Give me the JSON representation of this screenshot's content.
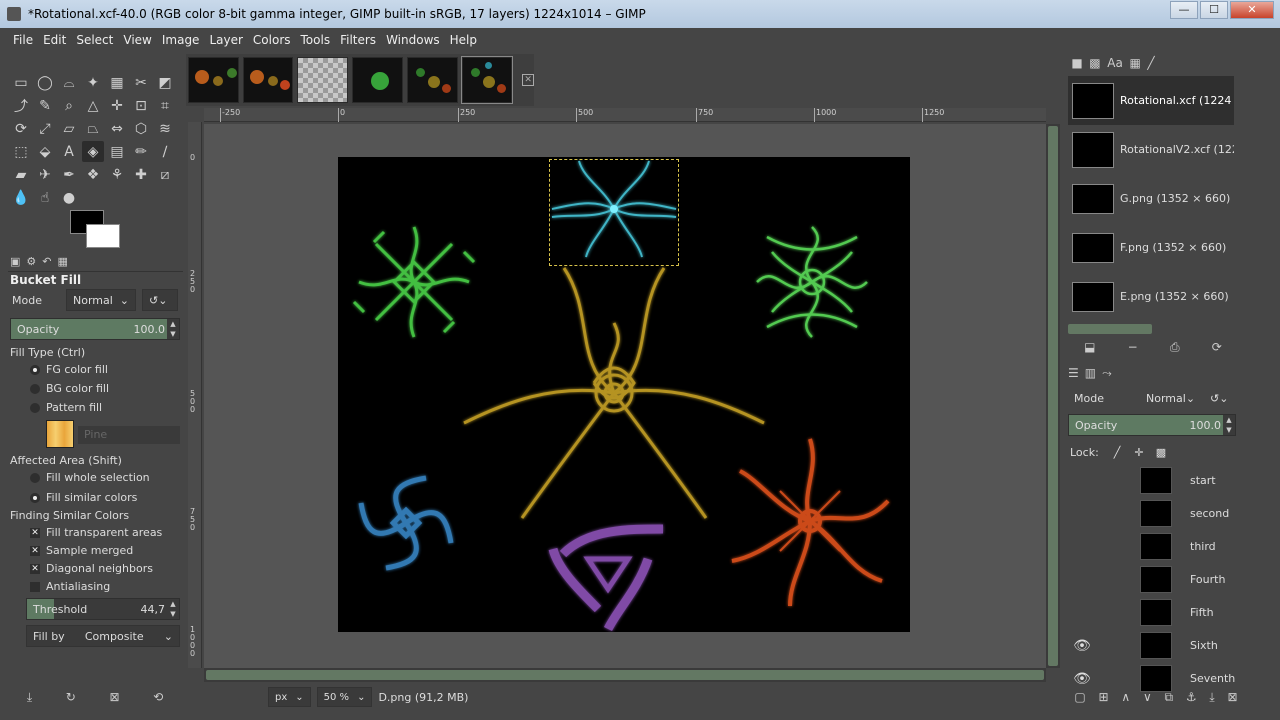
{
  "window": {
    "title": "*Rotational.xcf-40.0 (RGB color 8-bit gamma integer, GIMP built-in sRGB, 17 layers) 1224x1014 – GIMP",
    "minimize": "—",
    "maximize": "☐",
    "close": "✕"
  },
  "menu": [
    "File",
    "Edit",
    "Select",
    "View",
    "Image",
    "Layer",
    "Colors",
    "Tools",
    "Filters",
    "Windows",
    "Help"
  ],
  "tool_options": {
    "title": "Bucket Fill",
    "mode_label": "Mode",
    "mode_value": "Normal",
    "opacity_label": "Opacity",
    "opacity_value": "100.0",
    "fill_type_label": "Fill Type  (Ctrl)",
    "fill_type_options": [
      "FG color fill",
      "BG color fill",
      "Pattern fill"
    ],
    "pattern_name": "Pine",
    "affected_area_label": "Affected Area  (Shift)",
    "affected_area_options": [
      "Fill whole selection",
      "Fill similar colors"
    ],
    "finding_label": "Finding Similar Colors",
    "finding_options": [
      "Fill transparent areas",
      "Sample merged",
      "Diagonal neighbors",
      "Antialiasing"
    ],
    "threshold_label": "Threshold",
    "threshold_value": "44,7",
    "threshold_fraction": 0.175,
    "fill_by_label": "Fill by",
    "fill_by_value": "Composite"
  },
  "ruler": {
    "top": [
      "-250",
      "0",
      "250",
      "500",
      "750",
      "1000",
      "1250"
    ],
    "left": [
      "0",
      "250",
      "500",
      "750",
      "1000"
    ]
  },
  "status": {
    "unit": "px",
    "zoom": "50 %",
    "info": "D.png (91,2 MB)"
  },
  "images": [
    {
      "name": "Rotational.xcf (1224 ×"
    },
    {
      "name": "RotationalV2.xcf (1224"
    },
    {
      "name": "G.png (1352 × 660)"
    },
    {
      "name": "F.png (1352 × 660)"
    },
    {
      "name": "E.png (1352 × 660)"
    }
  ],
  "layers_panel": {
    "mode_label": "Mode",
    "mode_value": "Normal",
    "opacity_label": "Opacity",
    "opacity_value": "100.0",
    "lock_label": "Lock:",
    "layers": [
      {
        "name": "start",
        "visible": false
      },
      {
        "name": "second",
        "visible": false
      },
      {
        "name": "third",
        "visible": false
      },
      {
        "name": "Fourth",
        "visible": false
      },
      {
        "name": "Fifth",
        "visible": false
      },
      {
        "name": "Sixth",
        "visible": true
      },
      {
        "name": "Seventh",
        "visible": true
      }
    ]
  },
  "colors": {
    "accent": "#637863",
    "selection": "#d7c24a"
  }
}
